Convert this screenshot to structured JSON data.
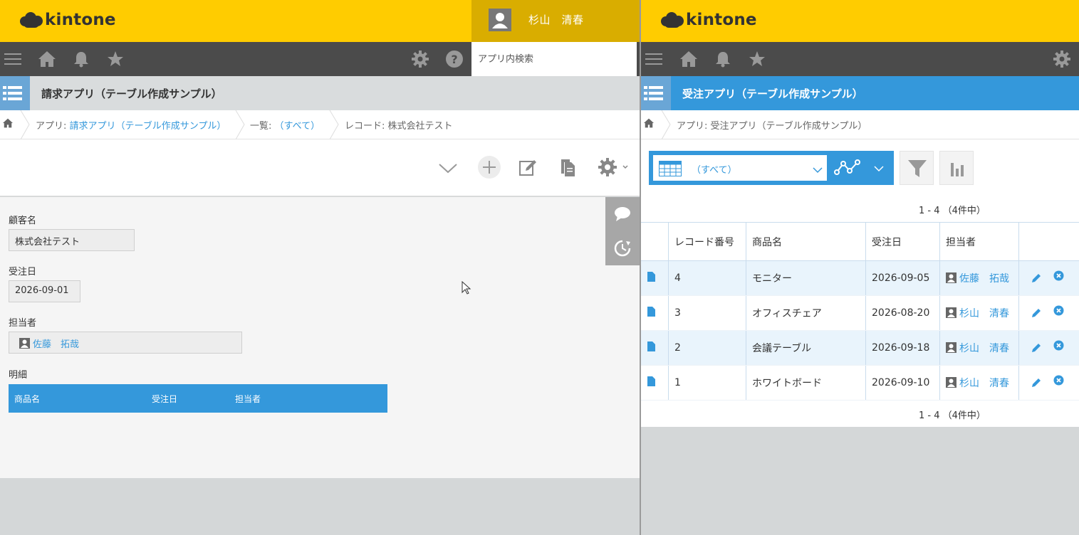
{
  "left": {
    "brand": "kintone",
    "user_name": "杉山　清春",
    "search_placeholder": "アプリ内検索",
    "app_title": "請求アプリ（テーブル作成サンプル）",
    "breadcrumb": {
      "app_prefix": "アプリ: ",
      "app_link": "請求アプリ（テーブル作成サンプル）",
      "list_prefix": "一覧: ",
      "list_link": "（すべて）",
      "record": "レコード: 株式会社テスト"
    },
    "fields": {
      "customer_label": "顧客名",
      "customer_value": "株式会社テスト",
      "order_date_label": "受注日",
      "order_date_value": "2026-09-01",
      "assignee_label": "担当者",
      "assignee_value": "佐藤　拓哉",
      "detail_label": "明細",
      "detail_columns": [
        "商品名",
        "受注日",
        "担当者"
      ]
    }
  },
  "right": {
    "brand": "kintone",
    "app_title": "受注アプリ（テーブル作成サンプル）",
    "breadcrumb_app": "アプリ: 受注アプリ（テーブル作成サンプル）",
    "view_name": "（すべて）",
    "pager_top": "1 - 4 （4件中）",
    "pager_bottom": "1 - 4 （4件中）",
    "columns": [
      "レコード番号",
      "商品名",
      "受注日",
      "担当者"
    ],
    "rows": [
      {
        "id": "4",
        "product": "モニター",
        "date": "2026-09-05",
        "assignee": "佐藤　拓哉"
      },
      {
        "id": "3",
        "product": "オフィスチェア",
        "date": "2026-08-20",
        "assignee": "杉山　清春"
      },
      {
        "id": "2",
        "product": "会議テーブル",
        "date": "2026-09-18",
        "assignee": "杉山　清春"
      },
      {
        "id": "1",
        "product": "ホワイトボード",
        "date": "2026-09-10",
        "assignee": "杉山　清春"
      }
    ]
  },
  "colors": {
    "header_yellow": "#ffcc00",
    "user_box": "#d9ad00",
    "nav_dark": "#4b4b4b",
    "accent_blue": "#3498db"
  }
}
